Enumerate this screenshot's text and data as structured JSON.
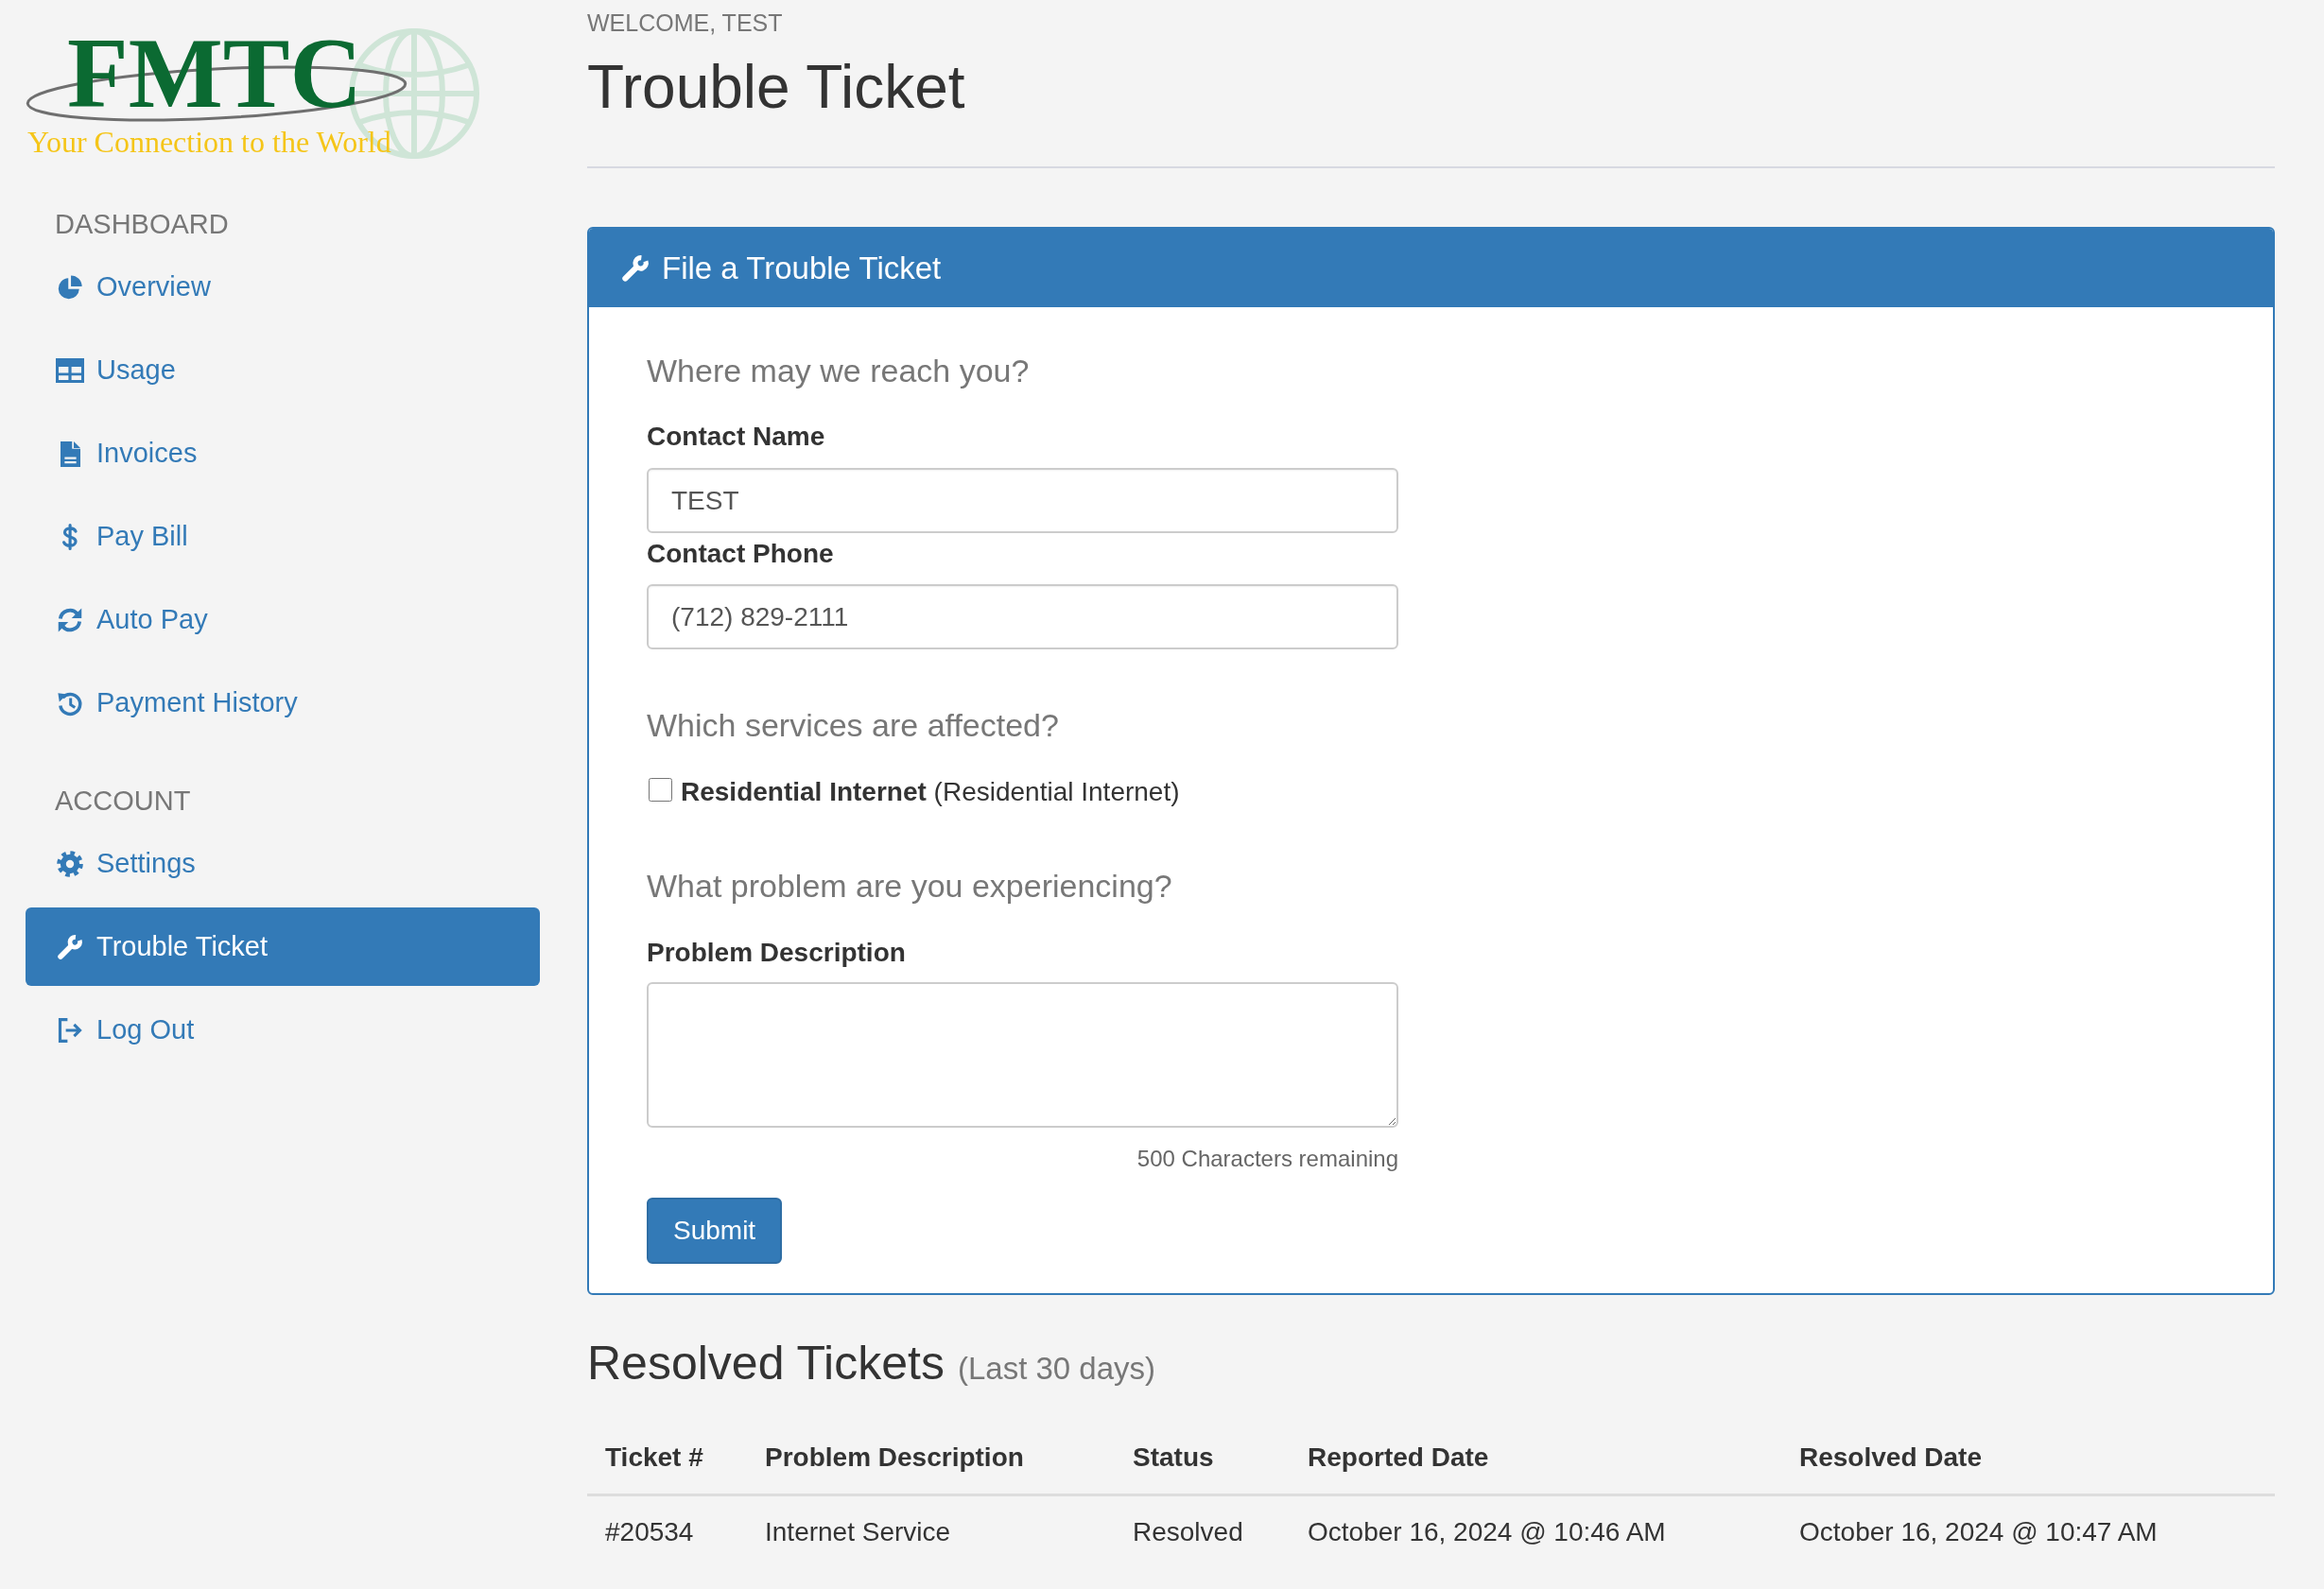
{
  "logo": {
    "wordmark": "FMTC",
    "tagline": "Your Connection to the World"
  },
  "sidebar": {
    "sections": [
      {
        "heading": "DASHBOARD",
        "items": [
          {
            "label": "Overview",
            "selected": false
          },
          {
            "label": "Usage",
            "selected": false
          },
          {
            "label": "Invoices",
            "selected": false
          },
          {
            "label": "Pay Bill",
            "selected": false
          },
          {
            "label": "Auto Pay",
            "selected": false
          },
          {
            "label": "Payment History",
            "selected": false
          }
        ]
      },
      {
        "heading": "ACCOUNT",
        "items": [
          {
            "label": "Settings",
            "selected": false
          },
          {
            "label": "Trouble Ticket",
            "selected": true
          },
          {
            "label": "Log Out",
            "selected": false
          }
        ]
      }
    ]
  },
  "header": {
    "welcome": "WELCOME, TEST",
    "title": "Trouble Ticket"
  },
  "ticket_form": {
    "title": "File a Trouble Ticket",
    "contact": {
      "question": "Where may we reach you?",
      "fields": [
        {
          "label": "Contact Name",
          "value": "TEST"
        },
        {
          "label": "Contact Phone",
          "value": "(712) 829-2111"
        }
      ]
    },
    "services": {
      "question": "Which services are affected?",
      "options": [
        {
          "label": "**Residential Internet** (Residential Internet)",
          "checked": false
        }
      ]
    },
    "problem": {
      "question": "What problem are you experiencing?",
      "field_label": "Problem Description",
      "counter": "500 Characters remaining"
    },
    "submit": "Submit"
  },
  "resolved_tickets": {
    "title": "Resolved Tickets",
    "subtitle": "(Last 30 days)",
    "columns": [
      "Ticket #",
      "Problem Description",
      "Status",
      "Reported Date",
      "Resolved Date"
    ],
    "rows": [
      [
        "#20534",
        "Internet Service",
        "Resolved",
        "October 16, 2024 @ 10:46 AM",
        "October 16, 2024 @ 10:47 AM"
      ]
    ]
  }
}
